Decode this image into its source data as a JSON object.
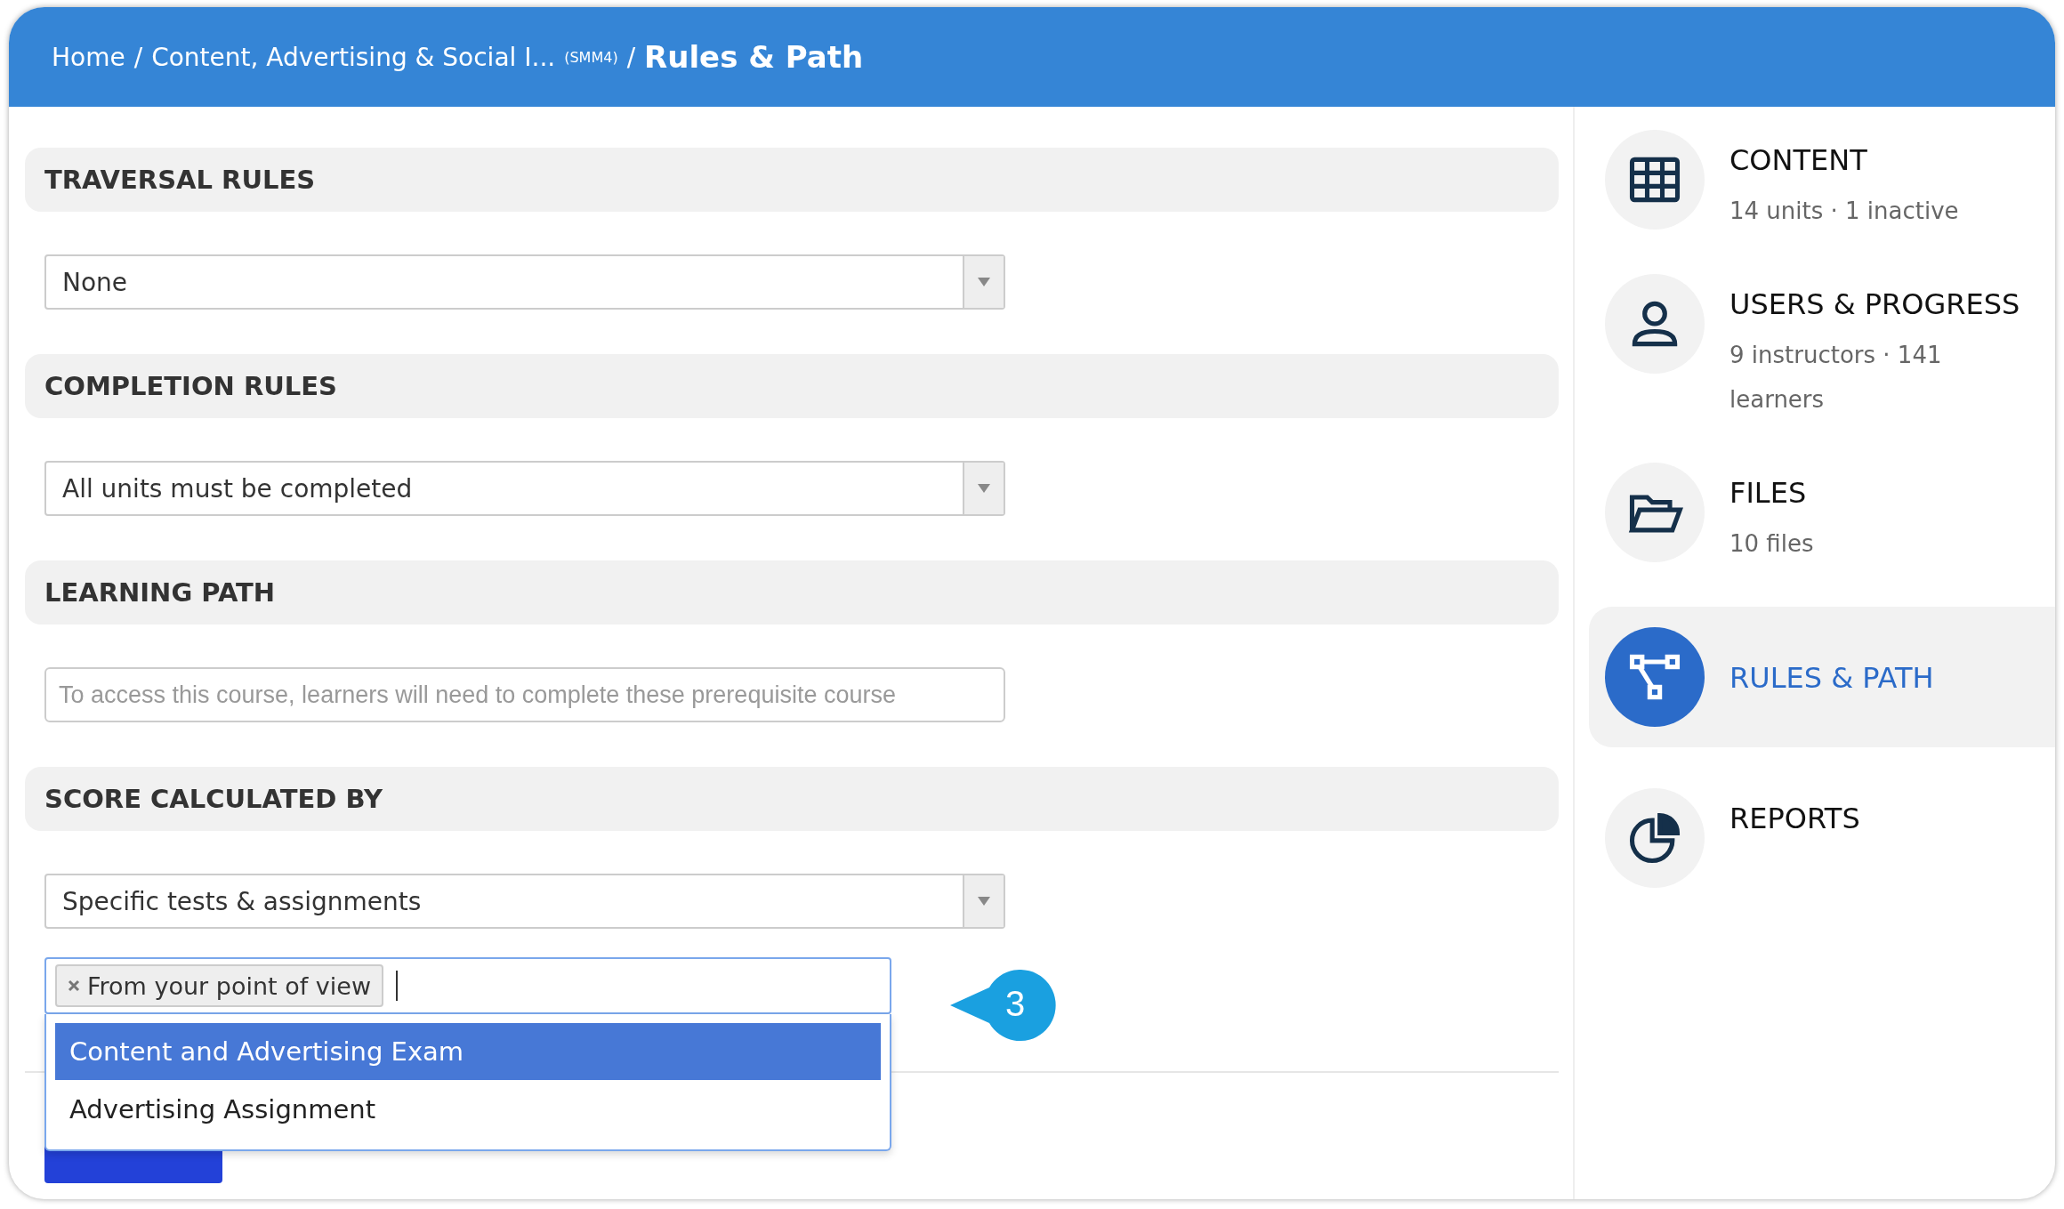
{
  "breadcrumb": {
    "links": [
      {
        "label": "Home",
        "separator": "/"
      },
      {
        "label": "Content, Advertising & Social I...",
        "code": "(SMM4)",
        "separator": "/"
      }
    ],
    "current": "Rules & Path"
  },
  "sections": [
    {
      "title": "TRAVERSAL RULES",
      "kind": "select",
      "value": "None"
    },
    {
      "title": "COMPLETION RULES",
      "kind": "select",
      "value": "All units must be completed"
    },
    {
      "title": "LEARNING PATH",
      "kind": "text",
      "placeholder": "To access this course, learners will need to complete these prerequisite course"
    },
    {
      "title": "SCORE CALCULATED BY",
      "kind": "select",
      "value": "Specific tests & assignments",
      "tags": [
        "From your point of view"
      ],
      "options": [
        {
          "label": "Content and Advertising Exam",
          "selected": true
        },
        {
          "label": "Advertising Assignment",
          "selected": false
        }
      ]
    }
  ],
  "callout": {
    "label": "3"
  },
  "sidebar": {
    "items": [
      {
        "kind": "grid",
        "title": "CONTENT",
        "subtitle": "14 units · 1 inactive",
        "selected": false
      },
      {
        "kind": "user",
        "title": "USERS & PROGRESS",
        "subtitle": "9 instructors · 141 learners",
        "selected": false
      },
      {
        "kind": "folder",
        "title": "FILES",
        "subtitle": "10 files",
        "selected": false
      },
      {
        "kind": "path",
        "title": "RULES & PATH",
        "selected": true
      },
      {
        "kind": "pie",
        "title": "REPORTS",
        "selected": false
      }
    ]
  }
}
